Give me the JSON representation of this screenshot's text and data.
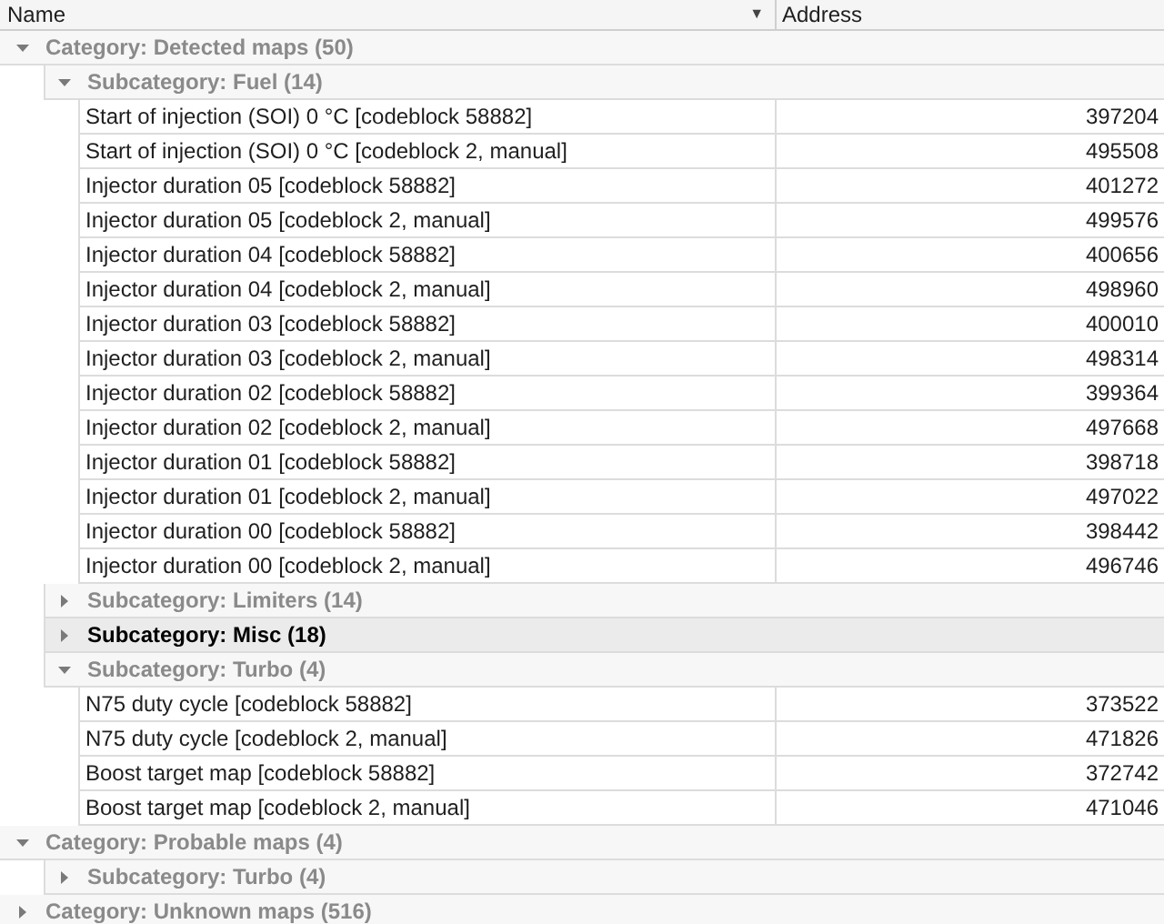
{
  "columns": [
    {
      "label": "Name",
      "sort_arrow": "▼"
    },
    {
      "label": "Address"
    }
  ],
  "tree": [
    {
      "kind": "category",
      "label": "Category: Detected maps (50)",
      "expanded": true,
      "selected": false,
      "children": [
        {
          "kind": "subcategory",
          "label": "Subcategory: Fuel (14)",
          "expanded": true,
          "selected": false,
          "children": [
            {
              "kind": "map",
              "name": "Start of injection (SOI) 0 °C [codeblock 58882]",
              "address": "397204"
            },
            {
              "kind": "map",
              "name": "Start of injection (SOI) 0 °C [codeblock 2, manual]",
              "address": "495508"
            },
            {
              "kind": "map",
              "name": "Injector duration 05 [codeblock 58882]",
              "address": "401272"
            },
            {
              "kind": "map",
              "name": "Injector duration 05 [codeblock 2, manual]",
              "address": "499576"
            },
            {
              "kind": "map",
              "name": "Injector duration 04 [codeblock 58882]",
              "address": "400656"
            },
            {
              "kind": "map",
              "name": "Injector duration 04 [codeblock 2, manual]",
              "address": "498960"
            },
            {
              "kind": "map",
              "name": "Injector duration 03 [codeblock 58882]",
              "address": "400010"
            },
            {
              "kind": "map",
              "name": "Injector duration 03 [codeblock 2, manual]",
              "address": "498314"
            },
            {
              "kind": "map",
              "name": "Injector duration 02 [codeblock 58882]",
              "address": "399364"
            },
            {
              "kind": "map",
              "name": "Injector duration 02 [codeblock 2, manual]",
              "address": "497668"
            },
            {
              "kind": "map",
              "name": "Injector duration 01 [codeblock 58882]",
              "address": "398718"
            },
            {
              "kind": "map",
              "name": "Injector duration 01 [codeblock 2, manual]",
              "address": "497022"
            },
            {
              "kind": "map",
              "name": "Injector duration 00 [codeblock 58882]",
              "address": "398442"
            },
            {
              "kind": "map",
              "name": "Injector duration 00 [codeblock 2, manual]",
              "address": "496746"
            }
          ]
        },
        {
          "kind": "subcategory",
          "label": "Subcategory: Limiters (14)",
          "expanded": false,
          "selected": false
        },
        {
          "kind": "subcategory",
          "label": "Subcategory: Misc (18)",
          "expanded": false,
          "selected": true
        },
        {
          "kind": "subcategory",
          "label": "Subcategory: Turbo (4)",
          "expanded": true,
          "selected": false,
          "children": [
            {
              "kind": "map",
              "name": "N75 duty cycle [codeblock 58882]",
              "address": "373522"
            },
            {
              "kind": "map",
              "name": "N75 duty cycle [codeblock 2, manual]",
              "address": "471826"
            },
            {
              "kind": "map",
              "name": "Boost target map [codeblock 58882]",
              "address": "372742"
            },
            {
              "kind": "map",
              "name": "Boost target map [codeblock 2, manual]",
              "address": "471046"
            }
          ]
        }
      ]
    },
    {
      "kind": "category",
      "label": "Category: Probable maps (4)",
      "expanded": true,
      "selected": false,
      "children": [
        {
          "kind": "subcategory",
          "label": "Subcategory: Turbo (4)",
          "expanded": false,
          "selected": false
        }
      ]
    },
    {
      "kind": "category",
      "label": "Category: Unknown maps (516)",
      "expanded": false,
      "selected": false
    }
  ]
}
